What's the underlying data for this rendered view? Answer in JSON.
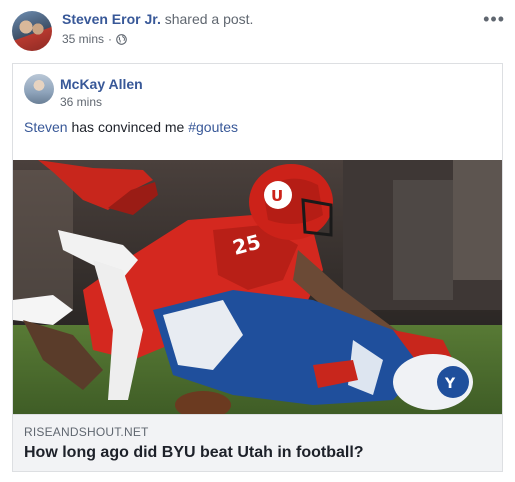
{
  "post": {
    "author_name": "Steven Eror Jr.",
    "action_text": "shared a post.",
    "time": "35 mins",
    "separator": "·",
    "more_icon": "more-options-icon",
    "privacy_icon": "globe-icon"
  },
  "shared_post": {
    "author_name": "McKay Allen",
    "time": "36 mins",
    "message_mention": "Steven",
    "message_text": "has convinced me",
    "message_hashtag": "#goutes"
  },
  "link_preview": {
    "domain": "RISEANDSHOUT.NET",
    "headline": "How long ago did BYU beat Utah in football?",
    "image_description_icon": "football-tackle-photo"
  },
  "colors": {
    "link": "#385898",
    "meta": "#606770",
    "text": "#1d2129",
    "preview_bg": "#f2f3f5",
    "utah_red": "#d4281f",
    "byu_blue": "#1f4f9c"
  }
}
